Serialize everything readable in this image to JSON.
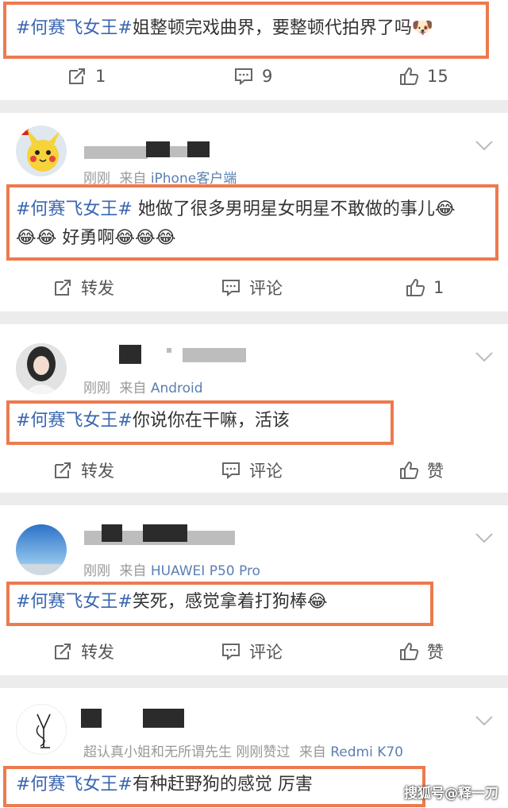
{
  "post": {
    "text_tag": "#何赛飞女王#",
    "text_body": "姐整顿完戏曲界，要整顿代拍界了吗",
    "repost_count": "1",
    "comment_count": "9",
    "like_count": "15"
  },
  "comments": [
    {
      "time": "刚刚",
      "source_prefix": "来自",
      "device": "iPhone客户端",
      "tag": "#何赛飞女王#",
      "line1": " 她做了很多男明星女明星不敢做的事儿",
      "line2": " 好勇啊",
      "repost_label": "转发",
      "comment_label": "评论",
      "like_label": "1"
    },
    {
      "time": "刚刚",
      "source_prefix": "来自",
      "device": "Android",
      "tag": "#何赛飞女王#",
      "line1": "你说你在干嘛，活该",
      "repost_label": "转发",
      "comment_label": "评论",
      "like_label": "赞"
    },
    {
      "time": "刚刚",
      "source_prefix": "来自",
      "device": "HUAWEI P50 Pro",
      "tag": "#何赛飞女王#",
      "line1": "笑死，感觉拿着打狗棒",
      "repost_label": "转发",
      "comment_label": "评论",
      "like_label": "赞"
    },
    {
      "time": "超认真小姐和无所谓先生 刚刚赞过",
      "source_prefix": "来自",
      "device": "Redmi K70",
      "tag": "#何赛飞女王#",
      "line1": "有种赶野狗的感觉 厉害"
    }
  ],
  "watermark": "搜狐号@释一刀",
  "colors": {
    "highlight_border": "#ed7a4f",
    "hashtag": "#3a66b0",
    "device_link": "#5b7fb0"
  }
}
